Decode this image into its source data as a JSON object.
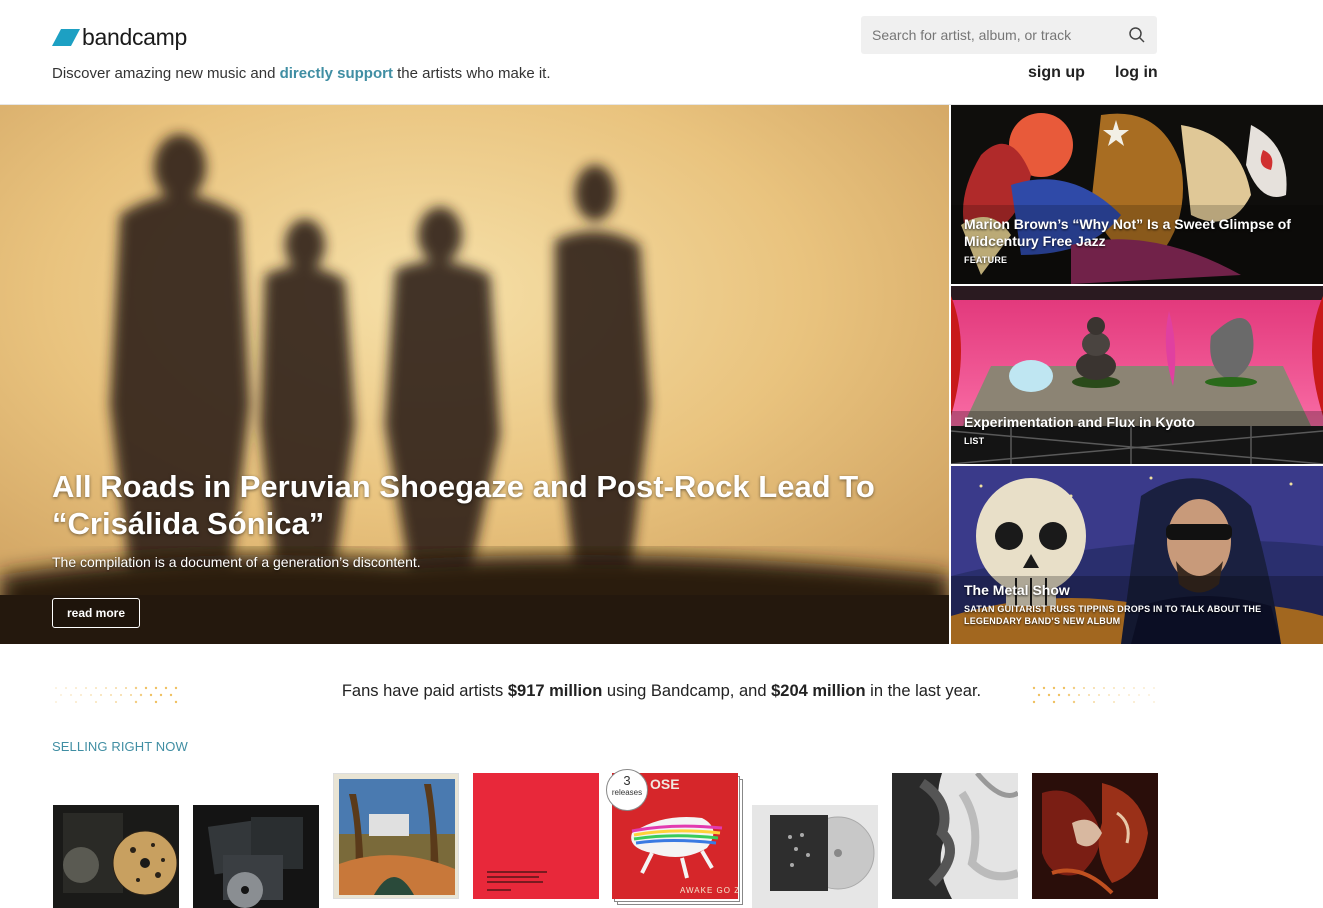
{
  "header": {
    "logo_text": "bandcamp",
    "tagline_pre": "Discover amazing new music and ",
    "tagline_highlight": "directly support",
    "tagline_post": " the artists who make it.",
    "search_placeholder": "Search for artist, album, or track",
    "signup_label": "sign up",
    "login_label": "log in"
  },
  "hero": {
    "title": "All Roads in Peruvian Shoegaze and Post-Rock Lead To “Crisálida Sónica”",
    "subtitle": "The compilation is a document of a generation’s discontent.",
    "button_label": "read more"
  },
  "features": [
    {
      "title": "Marion Brown’s “Why Not” Is a Sweet Glimpse of Midcentury Free Jazz",
      "category": "FEATURE"
    },
    {
      "title": "Experimentation and Flux in Kyoto",
      "category": "LIST"
    },
    {
      "title": "The Metal Show",
      "category": "SATAN GUITARIST RUSS TIPPINS DROPS IN TO TALK ABOUT THE LEGENDARY BAND’S NEW ALBUM"
    }
  ],
  "stats": {
    "pre": "Fans have paid artists ",
    "total": "$917 million",
    "mid": " using Bandcamp, and ",
    "year": "$204 million",
    "post": " in the last year."
  },
  "selling": {
    "heading": "SELLING RIGHT NOW",
    "releases_badge_count": "3",
    "releases_badge_label": "releases",
    "album5_text_top": "OSE",
    "album5_text_bottom": "AWAKE GO ZERO"
  },
  "colors": {
    "accent": "#408ea3",
    "logo_blue": "#1da0c3"
  }
}
